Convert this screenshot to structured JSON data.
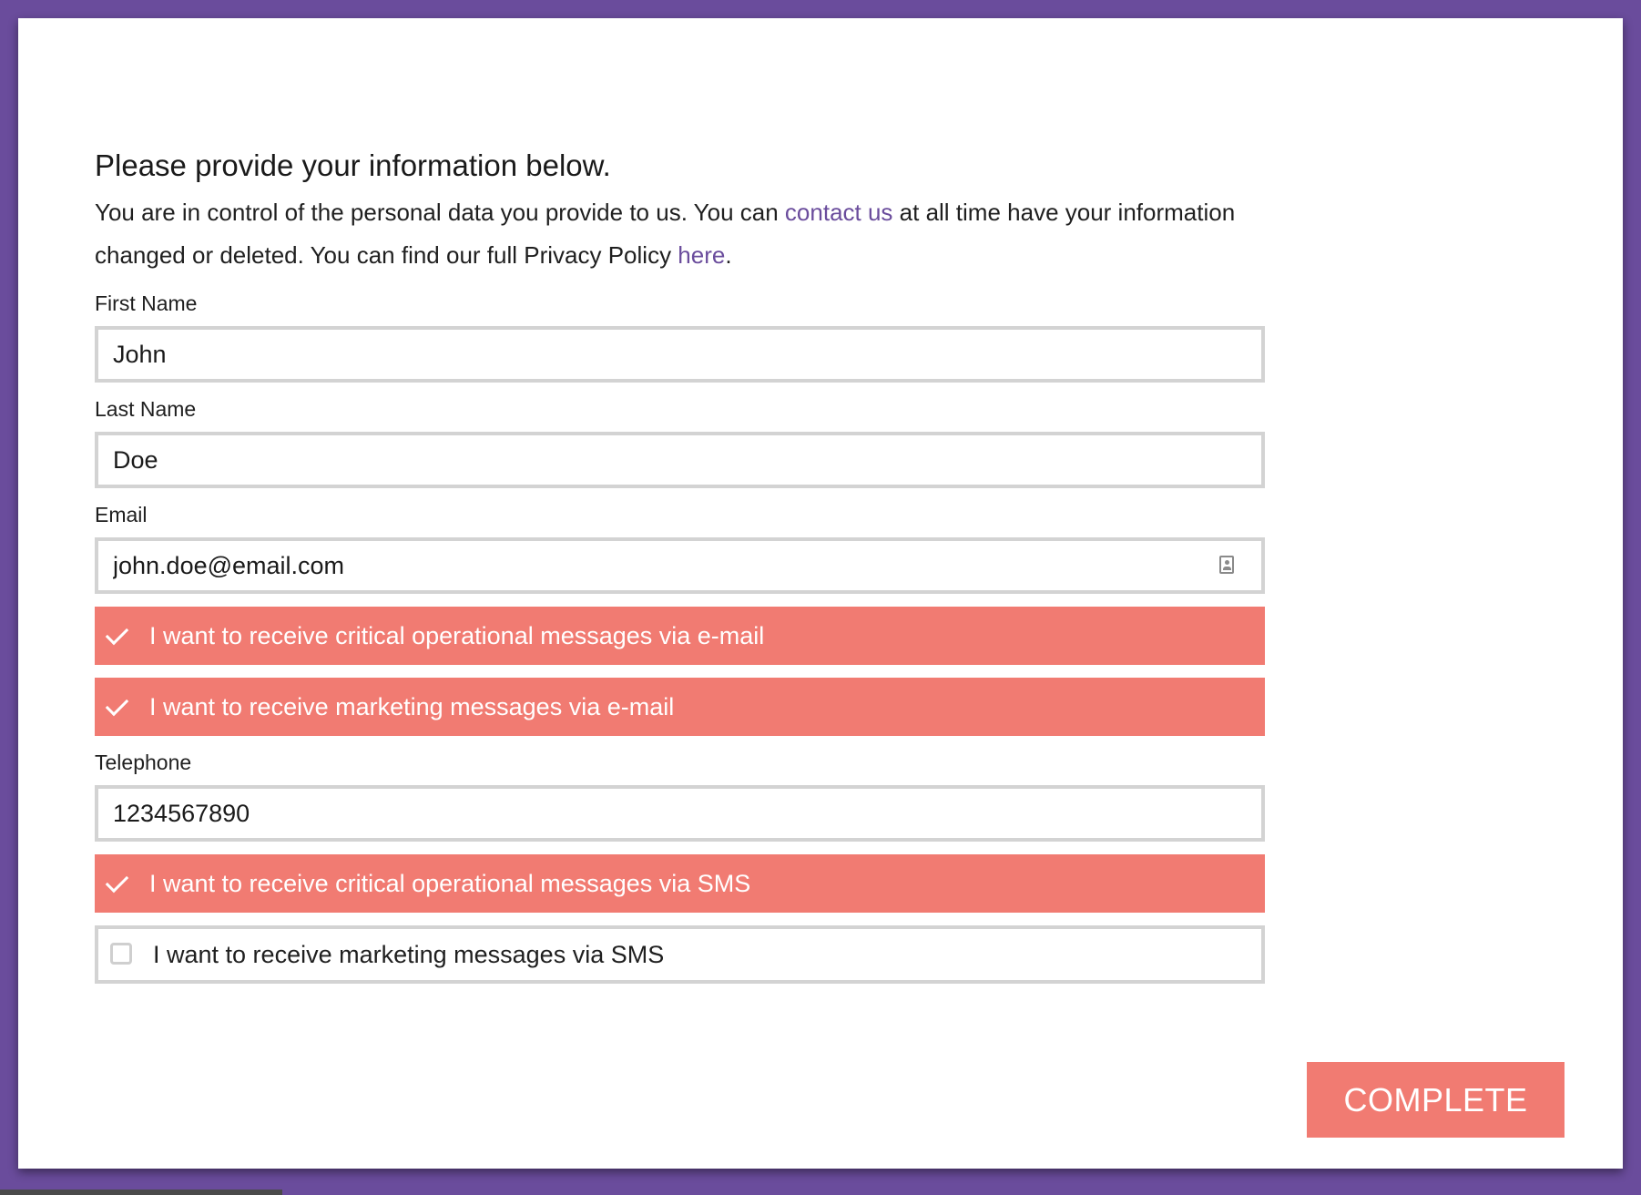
{
  "form": {
    "heading": "Please provide your information below.",
    "intro": {
      "part1": "You are in control of the personal data you provide to us. You can ",
      "contact_link": "contact us",
      "part2": " at all time have your information changed or deleted. You can find our full Privacy Policy ",
      "privacy_link": "here",
      "part3": "."
    },
    "fields": {
      "first_name": {
        "label": "First Name",
        "value": "John"
      },
      "last_name": {
        "label": "Last Name",
        "value": "Doe"
      },
      "email": {
        "label": "Email",
        "value": "john.doe@email.com",
        "icon": "contact-card-icon"
      },
      "telephone": {
        "label": "Telephone",
        "value": "1234567890"
      }
    },
    "consents": {
      "email_operational": {
        "label": "I want to receive critical operational messages via e-mail",
        "checked": true
      },
      "email_marketing": {
        "label": "I want to receive marketing messages via e-mail",
        "checked": true
      },
      "sms_operational": {
        "label": "I want to receive critical operational messages via SMS",
        "checked": true
      },
      "sms_marketing": {
        "label": "I want to receive marketing messages via SMS",
        "checked": false
      }
    },
    "complete_label": "COMPLETE"
  },
  "colors": {
    "background": "#6a4c9c",
    "accent": "#f17b72",
    "link": "#6a4c9c",
    "input_border": "#d3d3d3"
  }
}
